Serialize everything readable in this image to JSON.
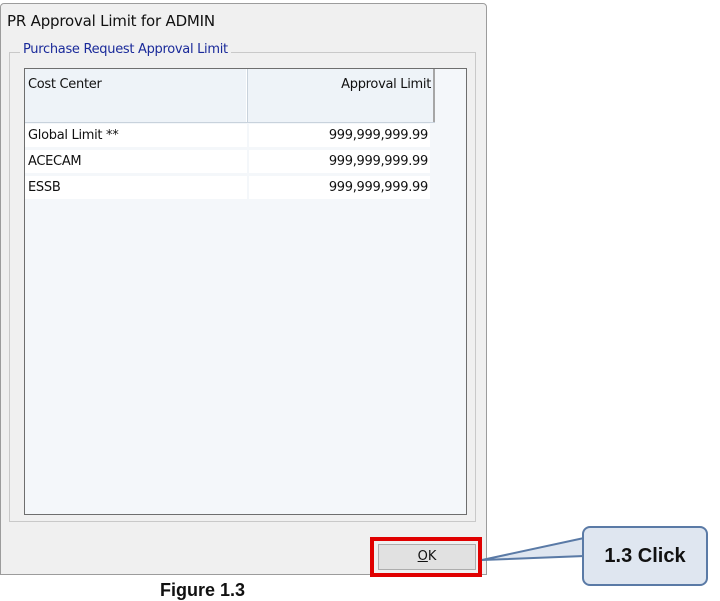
{
  "dialog": {
    "title": "PR Approval Limit for ADMIN",
    "group_title": "Purchase Request Approval Limit",
    "columns": [
      "Cost Center",
      "Approval Limit"
    ],
    "rows": [
      {
        "cost_center": "Global Limit **",
        "approval_limit": "999,999,999.99"
      },
      {
        "cost_center": "ACECAM",
        "approval_limit": "999,999,999.99"
      },
      {
        "cost_center": "ESSB",
        "approval_limit": "999,999,999.99"
      }
    ],
    "ok_button": {
      "mnemonic": "O",
      "rest": "K"
    }
  },
  "annotation": {
    "callout_text": "1.3 Click",
    "highlight_color": "#e00000",
    "callout_fill": "#dfe6f0",
    "callout_border": "#5a7aa6"
  },
  "caption": "Figure 1.3"
}
